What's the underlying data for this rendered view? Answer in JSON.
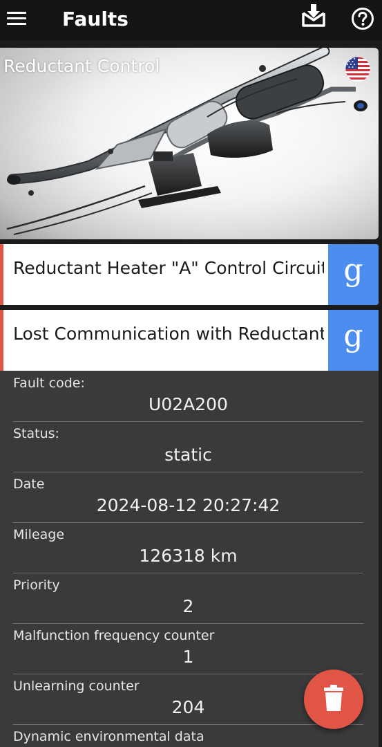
{
  "header": {
    "title": "Faults",
    "menu_icon": "hamburger-menu-icon",
    "download_icon": "download-tray-icon",
    "help_icon": "help-circle-icon"
  },
  "hero": {
    "title": "Reductant Control",
    "flag_icon": "us-flag-icon"
  },
  "fault_list": [
    {
      "text": "Reductant Heater \"A\" Control Circuit..",
      "search_label": "g"
    },
    {
      "text": "Lost Communication with Reductant Control",
      "search_label": "g"
    }
  ],
  "details": [
    {
      "label": "Fault code:",
      "value": "U02A200"
    },
    {
      "label": "Status:",
      "value": "static"
    },
    {
      "label": "Date",
      "value": "2024-08-12 20:27:42"
    },
    {
      "label": "Mileage",
      "value": "126318 km"
    },
    {
      "label": "Priority",
      "value": "2"
    },
    {
      "label": "Malfunction frequency counter",
      "value": "1"
    },
    {
      "label": "Unlearning counter",
      "value": "204"
    },
    {
      "label": "Dynamic environmental data",
      "value": ""
    }
  ],
  "fab": {
    "icon": "trash-icon"
  },
  "colors": {
    "accent_red": "#e05545",
    "google_blue": "#4c8ef0",
    "panel_bg": "#3a3a3a",
    "topbar_bg": "#141414"
  }
}
